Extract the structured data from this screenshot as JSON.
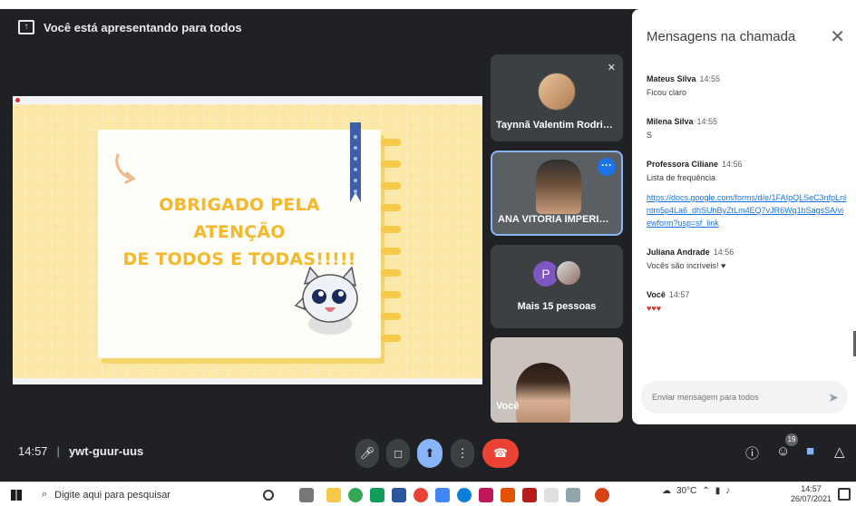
{
  "banner": {
    "text": "Você está apresentando para todos"
  },
  "slide": {
    "line1": "OBRIGADO PELA ATENÇÃO",
    "line2": "DE TODOS E TODAS!!!!!"
  },
  "participants": [
    {
      "name": "Taynnã Valentim Rodrigues"
    },
    {
      "name": "ANA VITORIA IMPERIAN..."
    },
    {
      "name": "Mais 15 pessoas",
      "avatar_letter": "P"
    },
    {
      "name": "Você"
    }
  ],
  "chat": {
    "title": "Mensagens na chamada",
    "messages": [
      {
        "author": "Mateus Silva",
        "time": "14:55",
        "text": "Ficou claro"
      },
      {
        "author": "Milena Silva",
        "time": "14:55",
        "text": "S"
      },
      {
        "author": "Professora Ciliane",
        "time": "14:56",
        "text": "Lista de frequência",
        "link": "https://docs.google.com/forms/d/e/1FAIpQLSeC3nfpLnlntm5p4La6_dhSUhByZtLm4EQ7vJR6Wq1bSagsSA/viewform?usp=sf_link"
      },
      {
        "author": "Juliana Andrade",
        "time": "14:56",
        "text": "Vocês são incríveis! ♥"
      },
      {
        "author": "Você",
        "time": "14:57",
        "text": "♥♥♥"
      }
    ],
    "input_placeholder": "Enviar mensagem para todos"
  },
  "meeting": {
    "time": "14:57",
    "separator": "|",
    "code": "ywt-guur-uus",
    "participants_count": "19"
  },
  "taskbar": {
    "search_placeholder": "Digite aqui para pesquisar",
    "temperature": "30°C",
    "time": "14:57",
    "date": "26/07/2021"
  },
  "icons": {
    "present": "present-icon",
    "mic": "mic-icon",
    "camera": "camera-icon",
    "more": "more-vert-icon",
    "end_call": "end-call-icon",
    "info": "info-icon",
    "people": "people-icon",
    "chat": "chat-icon",
    "activities": "activities-icon"
  },
  "colors": {
    "end_call": "#ea4335",
    "present_active": "#8ab4f8",
    "chat_active": "#8ab4f8",
    "link": "#1a73e8",
    "slide_bg": "#fbe7a6",
    "slide_text": "#f5b82a"
  }
}
